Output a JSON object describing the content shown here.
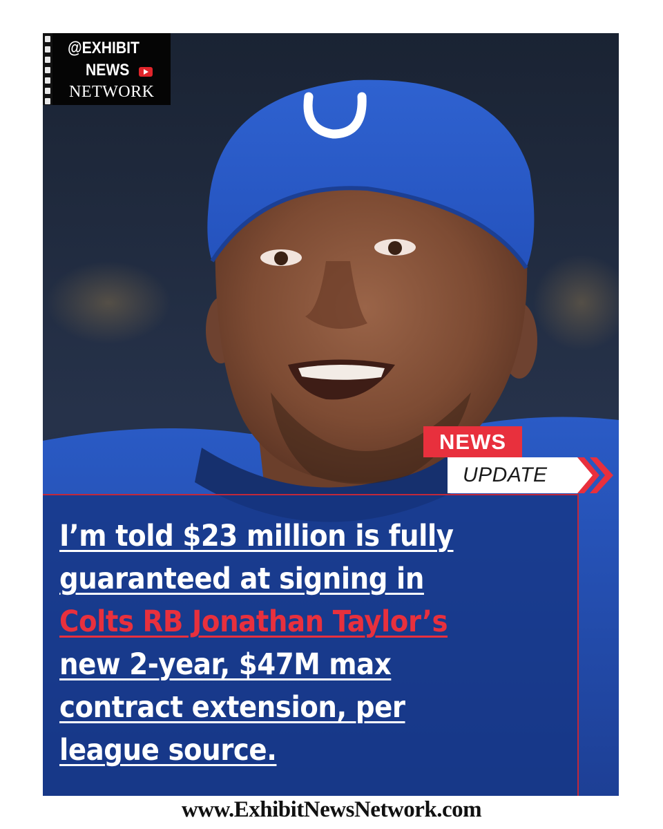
{
  "logo": {
    "line1": "@EXHIBIT",
    "line2": "NEWS",
    "line3": "NETWORK",
    "icon": "youtube-icon"
  },
  "labels": {
    "news": "NEWS",
    "update": "UPDATE"
  },
  "headline": {
    "lines": [
      "I’m told $23 million is fully",
      "guaranteed at signing in",
      "Colts RB Jonathan Taylor’s",
      "new 2-year, $47M max",
      "contract extension, per",
      "league source."
    ]
  },
  "footer": {
    "url": "www.ExhibitNewsNetwork.com"
  },
  "colors": {
    "accent_red": "#e8303d",
    "jersey_blue": "#1f4fb8",
    "headline_box": "#163684"
  }
}
